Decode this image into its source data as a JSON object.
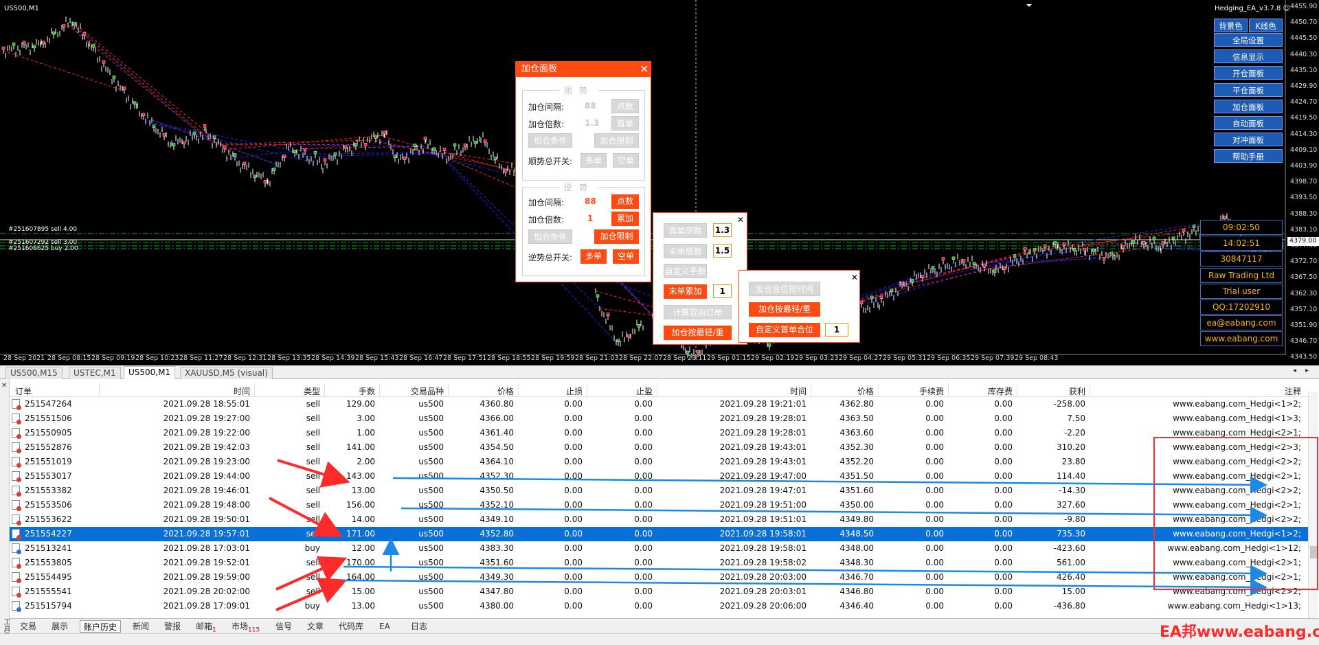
{
  "chart": {
    "symbol": "US500,M1",
    "ea_title": "Hedging_EA_v3.7.8",
    "ea_title_icon": "smiley-icon",
    "current_price": "4379.00",
    "price_ticks": [
      "4455.90",
      "4450.70",
      "4445.50",
      "4440.30",
      "4435.10",
      "4429.90",
      "4424.70",
      "4419.50",
      "4414.30",
      "4409.10",
      "4403.90",
      "4398.70",
      "4393.50",
      "4388.30",
      "4383.10",
      "4377.90",
      "4372.70",
      "4367.50",
      "4362.30",
      "4357.10",
      "4351.90",
      "4346.70",
      "4343.50"
    ],
    "time_ticks": [
      "28 Sep 2021",
      "28 Sep 08:15",
      "28 Sep 09:19",
      "28 Sep 10:23",
      "28 Sep 11:27",
      "28 Sep 12:31",
      "28 Sep 13:35",
      "28 Sep 14:39",
      "28 Sep 15:43",
      "28 Sep 16:47",
      "28 Sep 17:51",
      "28 Sep 18:55",
      "28 Sep 19:59",
      "28 Sep 21:03",
      "28 Sep 22:07",
      "28 Sep 23:11",
      "29 Sep 01:15",
      "29 Sep 02:19",
      "29 Sep 03:23",
      "29 Sep 04:27",
      "29 Sep 05:31",
      "29 Sep 06:35",
      "29 Sep 07:39",
      "29 Sep 08:43"
    ],
    "position_labels": [
      "#251607895 sell 4.00",
      "#251607292 sell 3.00",
      "#251606625 buy 2.00"
    ],
    "colors": {
      "bg": "#000000",
      "buy_marker": "#ff0033",
      "sell_marker": "#00c000",
      "blue_lines": "#2020ff",
      "red_lines": "#ff2020",
      "level_lines": "#00b400"
    }
  },
  "right_buttons": {
    "bg_color": "背景色",
    "k_color": "K线色",
    "items": [
      "全局设置",
      "信息显示",
      "开仓面板",
      "平仓面板",
      "加仓面板",
      "自动面板",
      "对冲面板",
      "帮助手册"
    ]
  },
  "info_boxes": [
    "09:02:50",
    "14:02:51",
    "30847117",
    "Raw Trading Ltd",
    "Trial user",
    "QQ:17202910",
    "ea@eabang.com",
    "www.eabang.com"
  ],
  "add_panel": {
    "title": "加仓面板",
    "trend_group": "顺势",
    "counter_group": "逆势",
    "interval_label": "加仓间隔:",
    "multiplier_label": "加仓倍数:",
    "trend": {
      "interval": "88",
      "interval_btn": "点数",
      "multiplier": "1.3",
      "multiplier_btn": "首单",
      "cond_btn": "加仓条件",
      "limit_btn": "加仓限制",
      "switch_label": "顺势总开关:",
      "long_btn": "多单",
      "short_btn": "空单"
    },
    "counter": {
      "interval": "88",
      "interval_btn": "点数",
      "multiplier": "1",
      "multiplier_btn": "累加",
      "cond_btn": "加仓条件",
      "limit_btn": "加仓限制",
      "switch_label": "逆势总开关:",
      "long_btn": "多单",
      "short_btn": "空单"
    }
  },
  "sub_panel": {
    "first_mult_btn": "首单倍数",
    "first_mult": "1.3",
    "last_mult_btn": "末单倍数",
    "last_mult": "1.5",
    "custom_lots_btn": "自定义手数",
    "last_accum_btn": "末单累加",
    "last_accum": "1",
    "calc_btn": "计算双向订单",
    "by_light_heavy_btn": "加仓按最轻/重"
  },
  "sub_panel2": {
    "by_time_btn": "加仓合位按时间",
    "by_light_heavy_btn": "加仓按最轻/重",
    "custom_first_btn": "自定义首单合位",
    "custom_first_val": "1"
  },
  "chart_tabs": [
    "US500,M15",
    "USTEC,M1",
    "US500,M1",
    "XAUUSD,M5 (visual)"
  ],
  "grid": {
    "headers": [
      "订单",
      "时间",
      "类型",
      "手数",
      "交易品种",
      "价格",
      "止损",
      "止盈",
      "时间",
      "价格",
      "手续费",
      "库存费",
      "获利",
      "注释"
    ],
    "rows": [
      [
        "251547264",
        "2021.09.28 18:55:01",
        "sell",
        "129.00",
        "us500",
        "4360.80",
        "0.00",
        "0.00",
        "2021.09.28 19:21:01",
        "4362.80",
        "0.00",
        "0.00",
        "-258.00",
        "www.eabang.com_Hedgi<1>2;"
      ],
      [
        "251551506",
        "2021.09.28 19:27:00",
        "sell",
        "3.00",
        "us500",
        "4366.00",
        "0.00",
        "0.00",
        "2021.09.28 19:28:01",
        "4363.50",
        "0.00",
        "0.00",
        "7.50",
        "www.eabang.com_Hedgi<1>3;"
      ],
      [
        "251550905",
        "2021.09.28 19:22:00",
        "sell",
        "1.00",
        "us500",
        "4361.40",
        "0.00",
        "0.00",
        "2021.09.28 19:28:01",
        "4363.60",
        "0.00",
        "0.00",
        "-2.20",
        "www.eabang.com_Hedgi<2>1;"
      ],
      [
        "251552876",
        "2021.09.28 19:42:03",
        "sell",
        "141.00",
        "us500",
        "4354.50",
        "0.00",
        "0.00",
        "2021.09.28 19:43:01",
        "4352.30",
        "0.00",
        "0.00",
        "310.20",
        "www.eabang.com_Hedgi<2>3;"
      ],
      [
        "251551019",
        "2021.09.28 19:23:00",
        "sell",
        "2.00",
        "us500",
        "4364.10",
        "0.00",
        "0.00",
        "2021.09.28 19:43:01",
        "4352.20",
        "0.00",
        "0.00",
        "23.80",
        "www.eabang.com_Hedgi<2>2;"
      ],
      [
        "251553017",
        "2021.09.28 19:44:00",
        "sell",
        "143.00",
        "us500",
        "4352.30",
        "0.00",
        "0.00",
        "2021.09.28 19:47:00",
        "4351.50",
        "0.00",
        "0.00",
        "114.40",
        "www.eabang.com_Hedgi<2>1;"
      ],
      [
        "251553382",
        "2021.09.28 19:46:01",
        "sell",
        "13.00",
        "us500",
        "4350.50",
        "0.00",
        "0.00",
        "2021.09.28 19:47:01",
        "4351.60",
        "0.00",
        "0.00",
        "-14.30",
        "www.eabang.com_Hedgi<2>2;"
      ],
      [
        "251553506",
        "2021.09.28 19:48:00",
        "sell",
        "156.00",
        "us500",
        "4352.10",
        "0.00",
        "0.00",
        "2021.09.28 19:51:00",
        "4350.00",
        "0.00",
        "0.00",
        "327.60",
        "www.eabang.com_Hedgi<2>1;"
      ],
      [
        "251553622",
        "2021.09.28 19:50:01",
        "sell",
        "14.00",
        "us500",
        "4349.10",
        "0.00",
        "0.00",
        "2021.09.28 19:51:01",
        "4349.80",
        "0.00",
        "0.00",
        "-9.80",
        "www.eabang.com_Hedgi<2>2;"
      ],
      [
        "251554227",
        "2021.09.28 19:57:01",
        "sell",
        "171.00",
        "us500",
        "4352.80",
        "0.00",
        "0.00",
        "2021.09.28 19:58:01",
        "4348.50",
        "0.00",
        "0.00",
        "735.30",
        "www.eabang.com_Hedgi<1>2;"
      ],
      [
        "251513241",
        "2021.09.28 17:03:01",
        "buy",
        "12.00",
        "us500",
        "4383.30",
        "0.00",
        "0.00",
        "2021.09.28 19:58:01",
        "4348.00",
        "0.00",
        "0.00",
        "-423.60",
        "www.eabang.com_Hedgi<1>12;"
      ],
      [
        "251553805",
        "2021.09.28 19:52:01",
        "sell",
        "170.00",
        "us500",
        "4351.60",
        "0.00",
        "0.00",
        "2021.09.28 19:58:02",
        "4348.30",
        "0.00",
        "0.00",
        "561.00",
        "www.eabang.com_Hedgi<2>1;"
      ],
      [
        "251554495",
        "2021.09.28 19:59:00",
        "sell",
        "164.00",
        "us500",
        "4349.30",
        "0.00",
        "0.00",
        "2021.09.28 20:03:00",
        "4346.70",
        "0.00",
        "0.00",
        "426.40",
        "www.eabang.com_Hedgi<2>1;"
      ],
      [
        "251555541",
        "2021.09.28 20:02:00",
        "sell",
        "15.00",
        "us500",
        "4347.80",
        "0.00",
        "0.00",
        "2021.09.28 20:03:01",
        "4346.80",
        "0.00",
        "0.00",
        "15.00",
        "www.eabang.com_Hedgi<2>2;"
      ],
      [
        "251515794",
        "2021.09.28 17:09:01",
        "buy",
        "13.00",
        "us500",
        "4380.00",
        "0.00",
        "0.00",
        "2021.09.28 20:06:00",
        "4346.40",
        "0.00",
        "0.00",
        "-436.80",
        "www.eabang.com_Hedgi<1>13;"
      ]
    ],
    "selected_row": 9
  },
  "terminal_title": "工具箱",
  "bottom_tabs": [
    {
      "label": "交易"
    },
    {
      "label": "展示"
    },
    {
      "label": "账户历史"
    },
    {
      "label": "新闻"
    },
    {
      "label": "警报"
    },
    {
      "label": "邮箱",
      "badge": "1"
    },
    {
      "label": "市场",
      "badge": "115"
    },
    {
      "label": "信号"
    },
    {
      "label": "文章"
    },
    {
      "label": "代码库"
    },
    {
      "label": "EA"
    },
    {
      "label": "日志"
    }
  ],
  "watermark": "EA邦www.eabang.com",
  "annotation_colors": {
    "arrow": "#ff2a2a",
    "underline": "#1e88e5",
    "box": "#ff2a2a"
  }
}
